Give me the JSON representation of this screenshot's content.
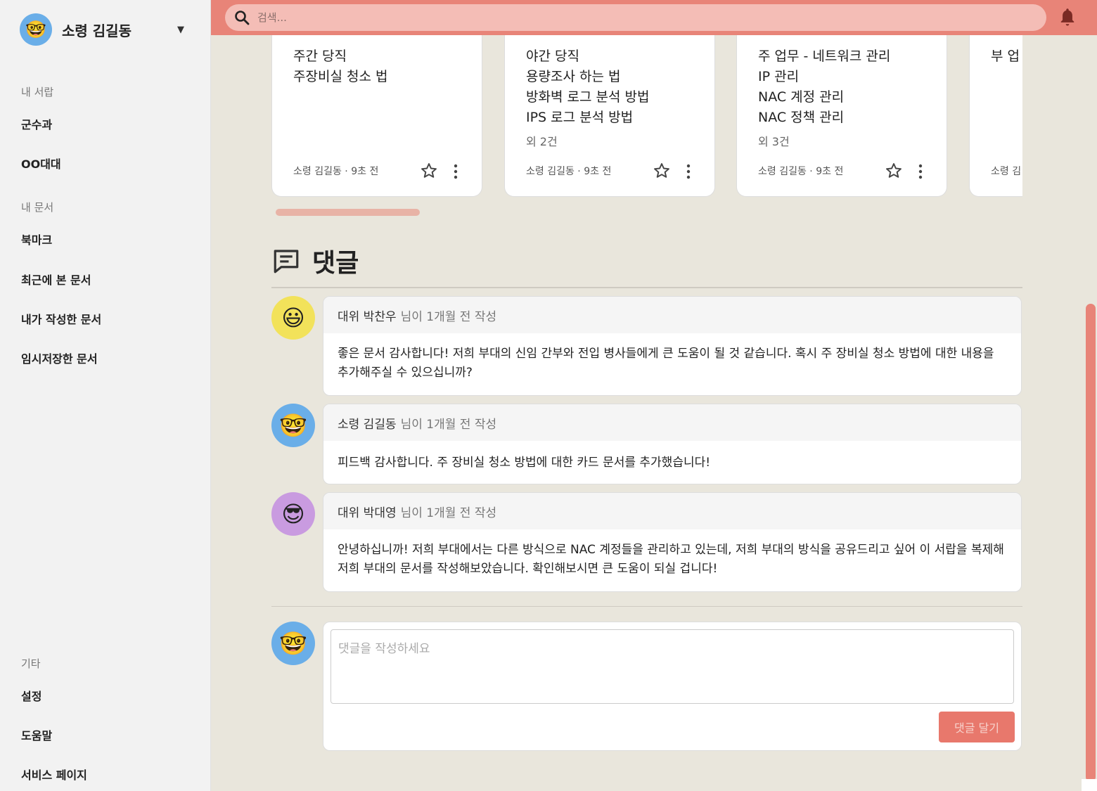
{
  "sidebar": {
    "user": {
      "name": "소령 김길동",
      "avatar": "man-with-glasses-avatar"
    },
    "sections": [
      {
        "title": "내 서랍",
        "items": [
          "군수과",
          "OO대대"
        ]
      },
      {
        "title": "내 문서",
        "items": [
          "북마크",
          "최근에 본 문서",
          "내가 작성한 문서",
          "임시저장한 문서"
        ]
      },
      {
        "title": "기타",
        "items": [
          "설정",
          "도움말",
          "서비스 페이지"
        ]
      }
    ]
  },
  "topbar": {
    "search_placeholder": "검색...",
    "accent": "#e88478"
  },
  "cards": [
    {
      "lines": [
        "주간 당직",
        "주장비실 청소 법"
      ],
      "more": "",
      "author": "소령 김길동",
      "time": "9초 전"
    },
    {
      "lines": [
        "야간 당직",
        "용량조사 하는 법",
        "방화벽 로그 분석 방법",
        "IPS 로그 분석 방법"
      ],
      "more": "외 2건",
      "author": "소령 김길동",
      "time": "9초 전"
    },
    {
      "lines": [
        "주 업무 - 네트워크 관리",
        "IP 관리",
        "NAC 계정 관리",
        "NAC 정책 관리"
      ],
      "more": "외 3건",
      "author": "소령 김길동",
      "time": "9초 전"
    },
    {
      "lines": [
        "부 업"
      ],
      "more": "",
      "author": "소령 김",
      "time": ""
    }
  ],
  "comments_section": {
    "title": "댓글",
    "items": [
      {
        "author": "대위 박찬우",
        "meta": "님이 1개월 전 작성",
        "body": "좋은 문서 감사합니다! 저희 부대의 신임 간부와 전입 병사들에게 큰 도움이 될 것 같습니다. 혹시 주 장비실 청소 방법에 대한 내용을 추가해주실 수 있으십니까?"
      },
      {
        "author": "소령 김길동",
        "meta": "님이 1개월 전 작성",
        "body": "피드백 감사합니다. 주 장비실 청소 방법에 대한 카드 문서를 추가했습니다!"
      },
      {
        "author": "대위 박대영",
        "meta": "님이 1개월 전 작성",
        "body": "안녕하십니까! 저희 부대에서는 다른 방식으로 NAC 계정들을 관리하고 있는데, 저희 부대의 방식을 공유드리고 싶어 이 서랍을 복제해 저희 부대의 문서를 작성해보았습니다. 확인해보시면 큰 도움이 되실 겁니다!"
      }
    ],
    "compose": {
      "placeholder": "댓글을 작성하세요",
      "submit_label": "댓글 달기"
    }
  }
}
